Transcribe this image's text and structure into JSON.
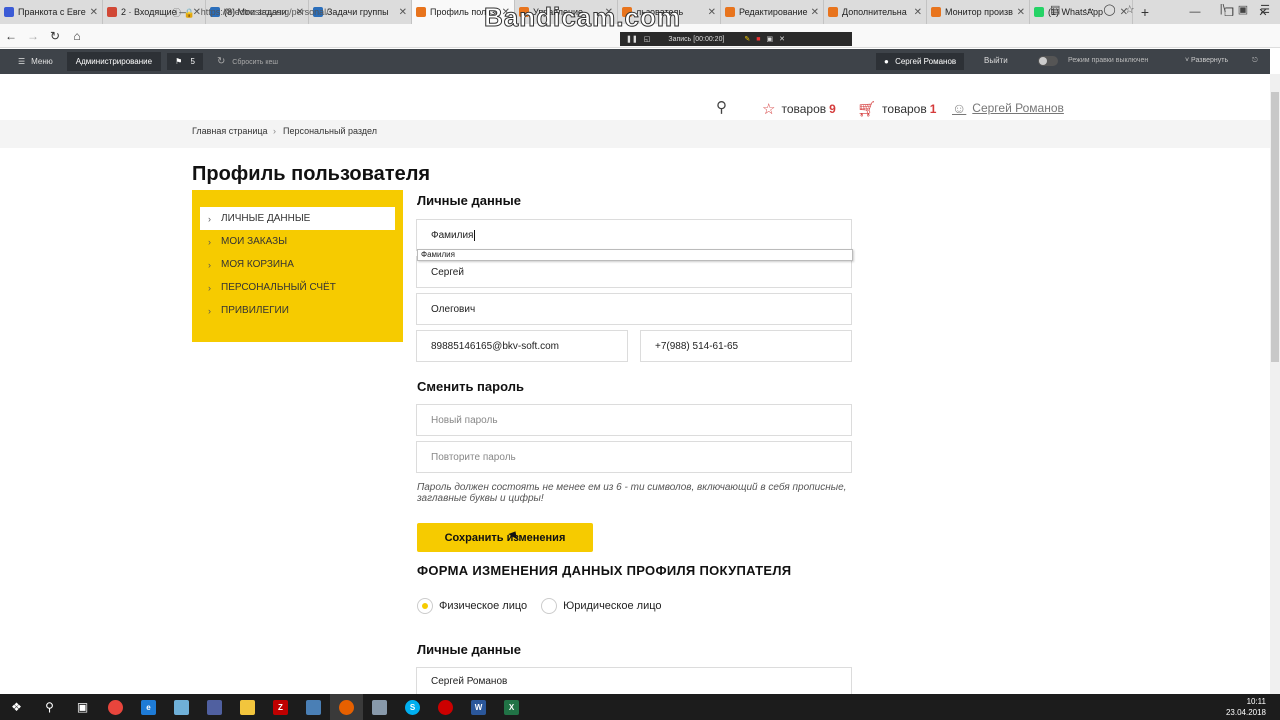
{
  "browser": {
    "tabs": [
      {
        "label": "Пранкота с Евге",
        "color": "#3b5bd6"
      },
      {
        "label": "2 · Входящие — Я",
        "color": "#d14836"
      },
      {
        "label": "(8) Мои задачи",
        "color": "#2a6ebb"
      },
      {
        "label": "Задачи группы",
        "color": "#2a6ebb"
      },
      {
        "label": "Профиль пользо",
        "color": "#e8741d"
      },
      {
        "label": "Управление",
        "color": "#e8741d"
      },
      {
        "label": "льзователь",
        "color": "#e8741d"
      },
      {
        "label": "Редактирование",
        "color": "#e8741d"
      },
      {
        "label": "Дополнительна",
        "color": "#e8741d"
      },
      {
        "label": "Монитор произв",
        "color": "#e8741d"
      },
      {
        "label": "(1) WhatsApp",
        "color": "#25d366"
      }
    ],
    "active_tab_index": 4,
    "new_tab_icon": "plus-icon",
    "url": "https://electrostroy.org/personal/",
    "overlay_title": "Bandicam.com",
    "recording_label": "Запись [00:00:20]"
  },
  "admin_bar": {
    "menu_label": "Меню",
    "admin_label": "Администрирование",
    "notif_count": "5",
    "cache_label": "Сбросить кеш",
    "user_label": "Сергей Романов",
    "exit_label": "Выйти",
    "mode_label": "Режим правки выключен",
    "expand_label": "Развернуть"
  },
  "header": {
    "favorites_label": "товаров",
    "favorites_count": "9",
    "cart_label": "товаров",
    "cart_count": "1",
    "user_name": "Сергей Романов"
  },
  "breadcrumb": {
    "home": "Главная страница",
    "separator": "›",
    "current": "Персональный раздел"
  },
  "page_title": "Профиль пользователя",
  "side_menu": {
    "items": [
      {
        "label": "ЛИЧНЫЕ ДАННЫЕ"
      },
      {
        "label": "МОИ ЗАКАЗЫ"
      },
      {
        "label": "МОЯ КОРЗИНА"
      },
      {
        "label": "ПЕРСОНАЛЬНЫЙ СЧЁТ"
      },
      {
        "label": "ПРИВИЛЕГИИ"
      }
    ],
    "active_index": 0,
    "accent_color": "#f6cb00"
  },
  "personal": {
    "title": "Личные данные",
    "lastname_value": "Фамилия",
    "autocomplete_suggestion": "Фамилия",
    "firstname_value": "Сергей",
    "middlename_value": "Олегович",
    "email_value": "89885146165@bkv-soft.com",
    "phone_value": "+7(988) 514-61-65"
  },
  "password": {
    "title": "Сменить пароль",
    "new_placeholder": "Новый пароль",
    "repeat_placeholder": "Повторите пароль",
    "hint": "Пароль должен состоять не менее ем из 6 - ти символов, включающий в себя прописные, заглавные буквы и цифры!"
  },
  "save_button": "Сохранить изменения",
  "buyer_form": {
    "title": "ФОРМА ИЗМЕНЕНИЯ ДАННЫХ ПРОФИЛЯ ПОКУПАТЕЛЯ",
    "radio_individual": "Физическое лицо",
    "radio_legal": "Юридическое лицо",
    "selected": "individual",
    "section_title": "Личные данные",
    "fullname_value": "Сергей Романов"
  },
  "taskbar": {
    "time": "10:11",
    "date": "23.04.2018"
  }
}
